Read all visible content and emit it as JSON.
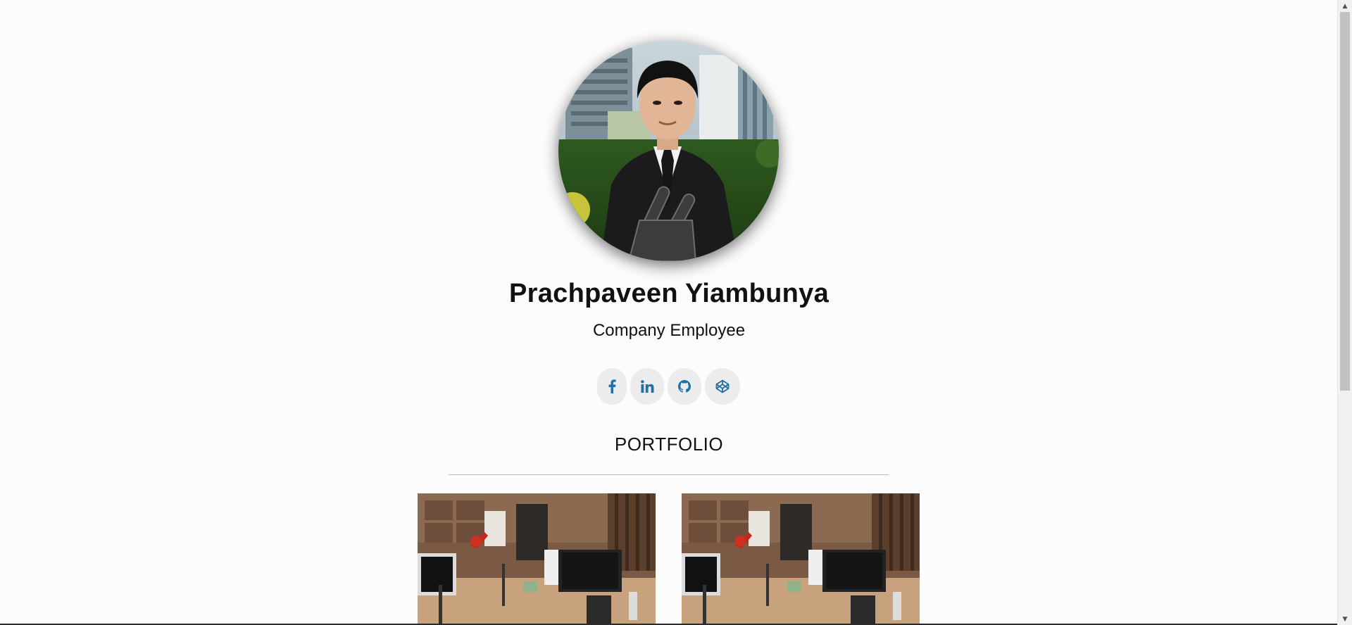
{
  "profile": {
    "name": "Prachpaveen Yiambunya",
    "role": "Company Employee",
    "avatar_icon": "profile-photo"
  },
  "socials": [
    {
      "name": "facebook",
      "icon": "facebook-icon"
    },
    {
      "name": "linkedin",
      "icon": "linkedin-icon"
    },
    {
      "name": "github",
      "icon": "github-icon"
    },
    {
      "name": "codepen",
      "icon": "codepen-icon"
    }
  ],
  "portfolio": {
    "title": "PORTFOLIO",
    "items": [
      {
        "image": "office-workspace-photo"
      },
      {
        "image": "office-workspace-photo"
      }
    ]
  },
  "scrollbar": {
    "up_arrow": "▲",
    "down_arrow": "▼"
  },
  "colors": {
    "background": "#fcfcfc",
    "social_bg": "#ececec",
    "social_icon": "#1f6fa8",
    "divider": "#bdbdbd"
  }
}
